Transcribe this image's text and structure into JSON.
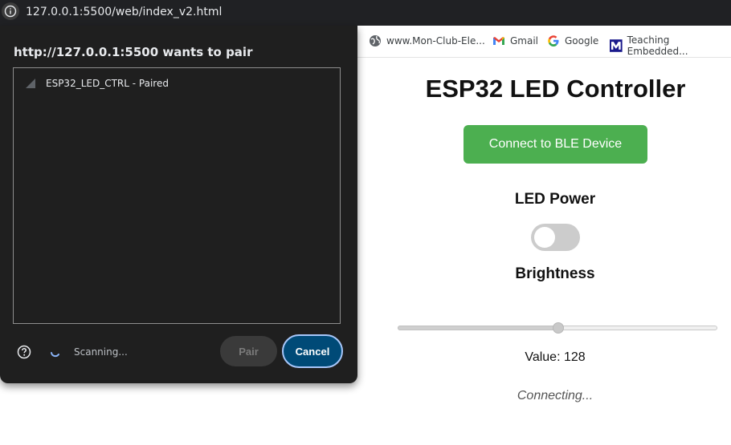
{
  "browser": {
    "url": "127.0.0.1:5500/web/index_v2.html",
    "bookmarks": [
      {
        "label": "www.Mon-Club-Ele...",
        "icon": "globe-icon"
      },
      {
        "label": "Gmail",
        "icon": "gmail-icon"
      },
      {
        "label": "Google",
        "icon": "google-icon"
      },
      {
        "label": "Teaching Embedded...",
        "icon": "m-logo-icon"
      }
    ]
  },
  "page": {
    "title": "ESP32 LED Controller",
    "connect_button": "Connect to BLE Device",
    "led_power_label": "LED Power",
    "led_power_on": false,
    "brightness_label": "Brightness",
    "brightness_value": 128,
    "brightness_max": 255,
    "value_text": "Value: 128",
    "status_text": "Connecting...",
    "colors": {
      "accent": "#4caf50"
    }
  },
  "dialog": {
    "title": "http://127.0.0.1:5500 wants to pair",
    "devices": [
      {
        "name": "ESP32_LED_CTRL - Paired",
        "icon": "signal-icon"
      }
    ],
    "scanning_text": "Scanning...",
    "pair_button": "Pair",
    "cancel_button": "Cancel"
  }
}
